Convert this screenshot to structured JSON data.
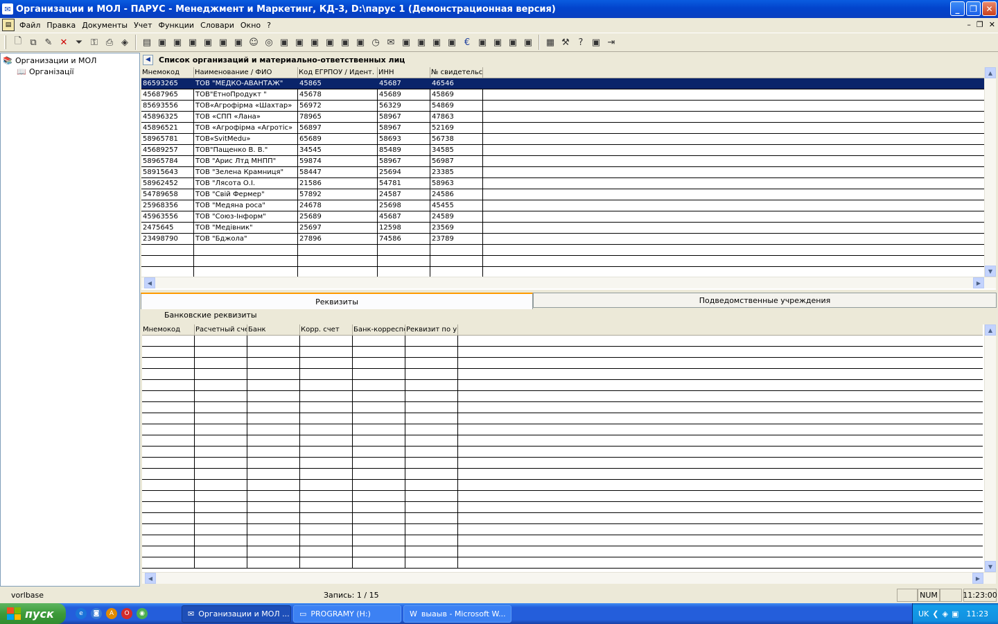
{
  "window": {
    "title": "Организации и МОЛ - ПАРУС - Менеджмент и Маркетинг, КД-3, D:\\парус 1 (Демонстрационная версия)"
  },
  "menu": [
    "Файл",
    "Правка",
    "Документы",
    "Учет",
    "Функции",
    "Словари",
    "Окно",
    "?"
  ],
  "toolbar_icons": [
    "new-doc-icon",
    "copy-doc-icon",
    "edit-icon",
    "delete-icon",
    "filter-icon",
    "find-icon",
    "print-icon",
    "cube-icon",
    "reports-icon",
    "tool-icon",
    "tool-icon",
    "tool-icon",
    "tool-icon",
    "tool-icon",
    "tool-icon",
    "person-icon",
    "globe-icon",
    "tool-icon",
    "tool-icon",
    "tool-icon",
    "tool-icon",
    "tool-icon",
    "tool-icon",
    "clock-icon",
    "mail-icon",
    "tool-icon",
    "tool-icon",
    "tool-icon",
    "tool-icon",
    "euro-icon",
    "tool-icon",
    "tool-icon",
    "tool-icon",
    "tool-icon",
    "calculator-icon",
    "tools-icon",
    "help-icon",
    "tool-icon",
    "exit-icon"
  ],
  "tree": {
    "root": "Организации и МОЛ",
    "child": "Організації"
  },
  "panel_title": "Список организаций и материально-ответственных лиц",
  "main_grid": {
    "columns": [
      "Мнемокод",
      "Наименование / ФИО",
      "Код ЕГРПОУ / Идент.",
      "ИНН",
      "№ свидетельст"
    ],
    "rows": [
      [
        "86593265",
        "ТОВ \"МЕДКО-АВАНТАЖ\"",
        "45865",
        "45687",
        "46546"
      ],
      [
        "45687965",
        "ТОВ\"ЕтноПродукт \"",
        "45678",
        "45689",
        "45869"
      ],
      [
        "85693556",
        "ТОВ«Агрофірма «Шахтар»",
        "56972",
        "56329",
        "54869"
      ],
      [
        "45896325",
        "ТОВ «СПП «Лана»",
        "78965",
        "58967",
        "47863"
      ],
      [
        "45896521",
        "ТОВ «Агрофірма «Агротіс»",
        "56897",
        "58967",
        "52169"
      ],
      [
        "58965781",
        "ТОВ«SvitMedu»",
        "65689",
        "58693",
        "56738"
      ],
      [
        "45689257",
        "ТОВ\"Пащенко В. В.\"",
        "34545",
        "85489",
        "34585"
      ],
      [
        "58965784",
        "ТОВ \"Арис Лтд МНПП\"",
        "59874",
        "58967",
        "56987"
      ],
      [
        "58915643",
        "ТОВ \"Зелена Крамниця\"",
        "58447",
        "25694",
        "23385"
      ],
      [
        "58962452",
        "ТОВ \"Лясота О.І.",
        "21586",
        "54781",
        "58963"
      ],
      [
        "54789658",
        "ТОВ \"Свій Фермер\"",
        "57892",
        "24587",
        "24586"
      ],
      [
        "25968356",
        "ТОВ \"Медяна роса\"",
        "24678",
        "25698",
        "45455"
      ],
      [
        "45963556",
        "ТОВ \"Союз-Інформ\"",
        "25689",
        "45687",
        "24589"
      ],
      [
        "2475645",
        "ТОВ \"Медівник\"",
        "25697",
        "12598",
        "23569"
      ],
      [
        "23498790",
        "ТОВ \"Бджола\"",
        "27896",
        "74586",
        "23789"
      ]
    ]
  },
  "tabs": [
    "Реквизиты",
    "Подведомственные учреждения"
  ],
  "sub_title": "Банковские реквизиты",
  "bank_grid": {
    "columns": [
      "Мнемокод",
      "Расчетный сче",
      "Банк",
      "Корр. счет",
      "Банк-корреспо",
      "Реквизит по ум"
    ]
  },
  "status": {
    "left": "vorlbase",
    "record": "Запись: 1 / 15",
    "num": "NUM",
    "time": "11:23:00"
  },
  "taskbar": {
    "start": "пуск",
    "tasks": [
      "Организации и МОЛ ...",
      "PROGRAMY (H:)",
      "выаыв - Microsoft W..."
    ],
    "lang": "UK",
    "clock": "11:23"
  }
}
